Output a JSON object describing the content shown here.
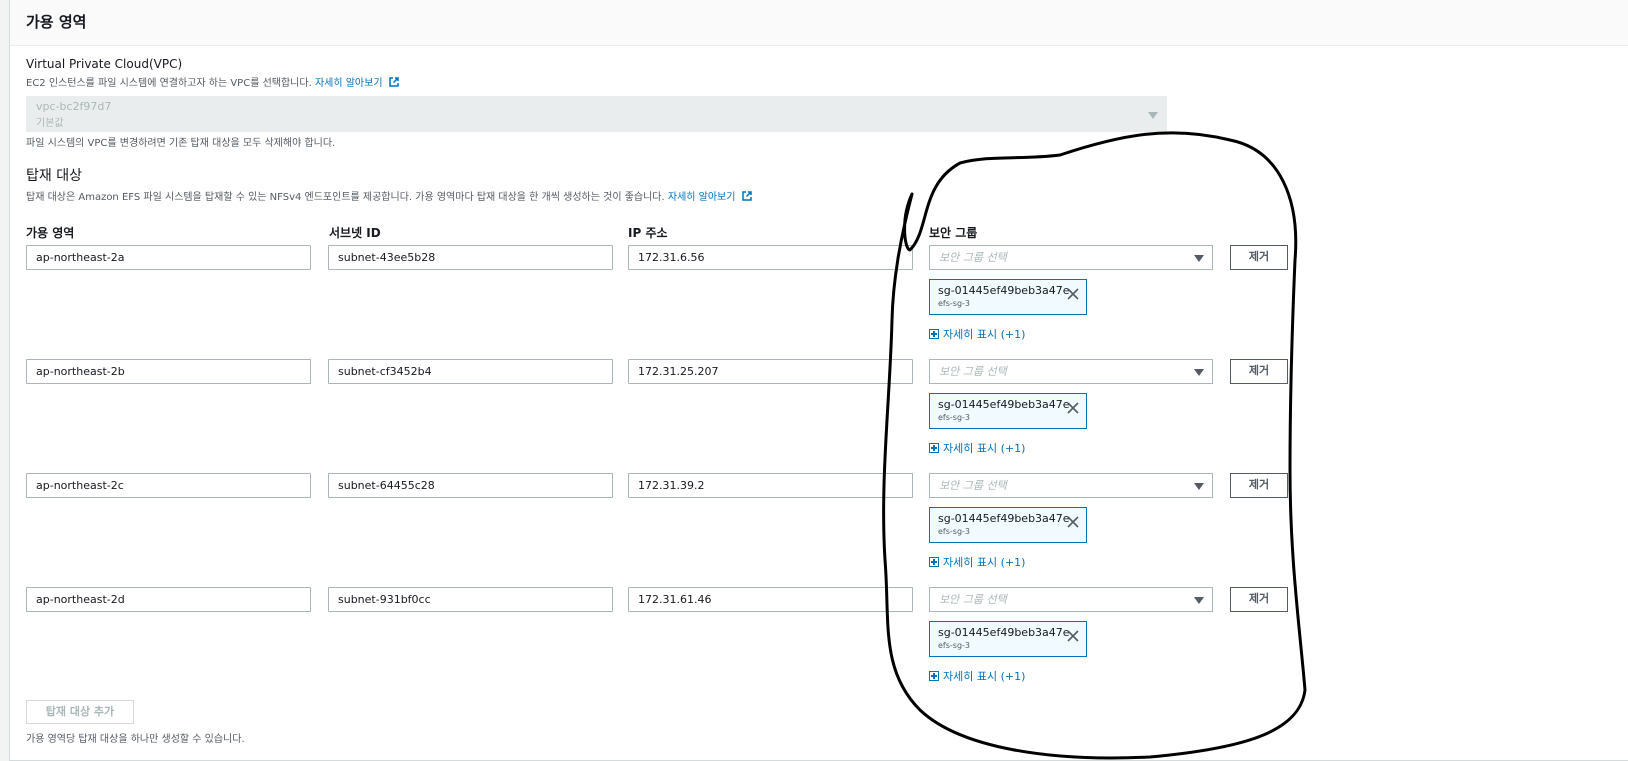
{
  "panel": {
    "title": "가용 영역"
  },
  "vpc": {
    "label": "Virtual Private Cloud(VPC)",
    "description": "EC2 인스턴스를 파일 시스템에 연결하고자 하는 VPC를 선택합니다.",
    "learn_more": "자세히 알아보기",
    "selected_value": "vpc-bc2f97d7",
    "selected_sub": "기본값",
    "note": "파일 시스템의 VPC를 변경하려면 기존 탑재 대상을 모두 삭제해야 합니다."
  },
  "mount_targets": {
    "title": "탑재 대상",
    "description": "탑재 대상은 Amazon EFS 파일 시스템을 탑재할 수 있는 NFSv4 엔드포인트를 제공합니다. 가용 영역마다 탑재 대상을 한 개씩 생성하는 것이 좋습니다.",
    "learn_more": "자세히 알아보기",
    "columns": {
      "az": "가용 영역",
      "subnet": "서브넷 ID",
      "ip": "IP 주소",
      "sg": "보안 그룹"
    },
    "sg_placeholder": "보안 그룹 선택",
    "remove_label": "제거",
    "show_more_label": "자세히 표시 (+1)",
    "rows": [
      {
        "az": "ap-northeast-2a",
        "subnet": "subnet-43ee5b28",
        "ip": "172.31.6.56",
        "token": {
          "id": "sg-01445ef49beb3a47e",
          "name": "efs-sg-3"
        }
      },
      {
        "az": "ap-northeast-2b",
        "subnet": "subnet-cf3452b4",
        "ip": "172.31.25.207",
        "token": {
          "id": "sg-01445ef49beb3a47e",
          "name": "efs-sg-3"
        }
      },
      {
        "az": "ap-northeast-2c",
        "subnet": "subnet-64455c28",
        "ip": "172.31.39.2",
        "token": {
          "id": "sg-01445ef49beb3a47e",
          "name": "efs-sg-3"
        }
      },
      {
        "az": "ap-northeast-2d",
        "subnet": "subnet-931bf0cc",
        "ip": "172.31.61.46",
        "token": {
          "id": "sg-01445ef49beb3a47e",
          "name": "efs-sg-3"
        }
      }
    ],
    "add_button": "탑재 대상 추가",
    "add_hint": "가용 영역당 탑재 대상을 하나만 생성할 수 있습니다."
  },
  "annotation": {
    "color": "#000000"
  }
}
